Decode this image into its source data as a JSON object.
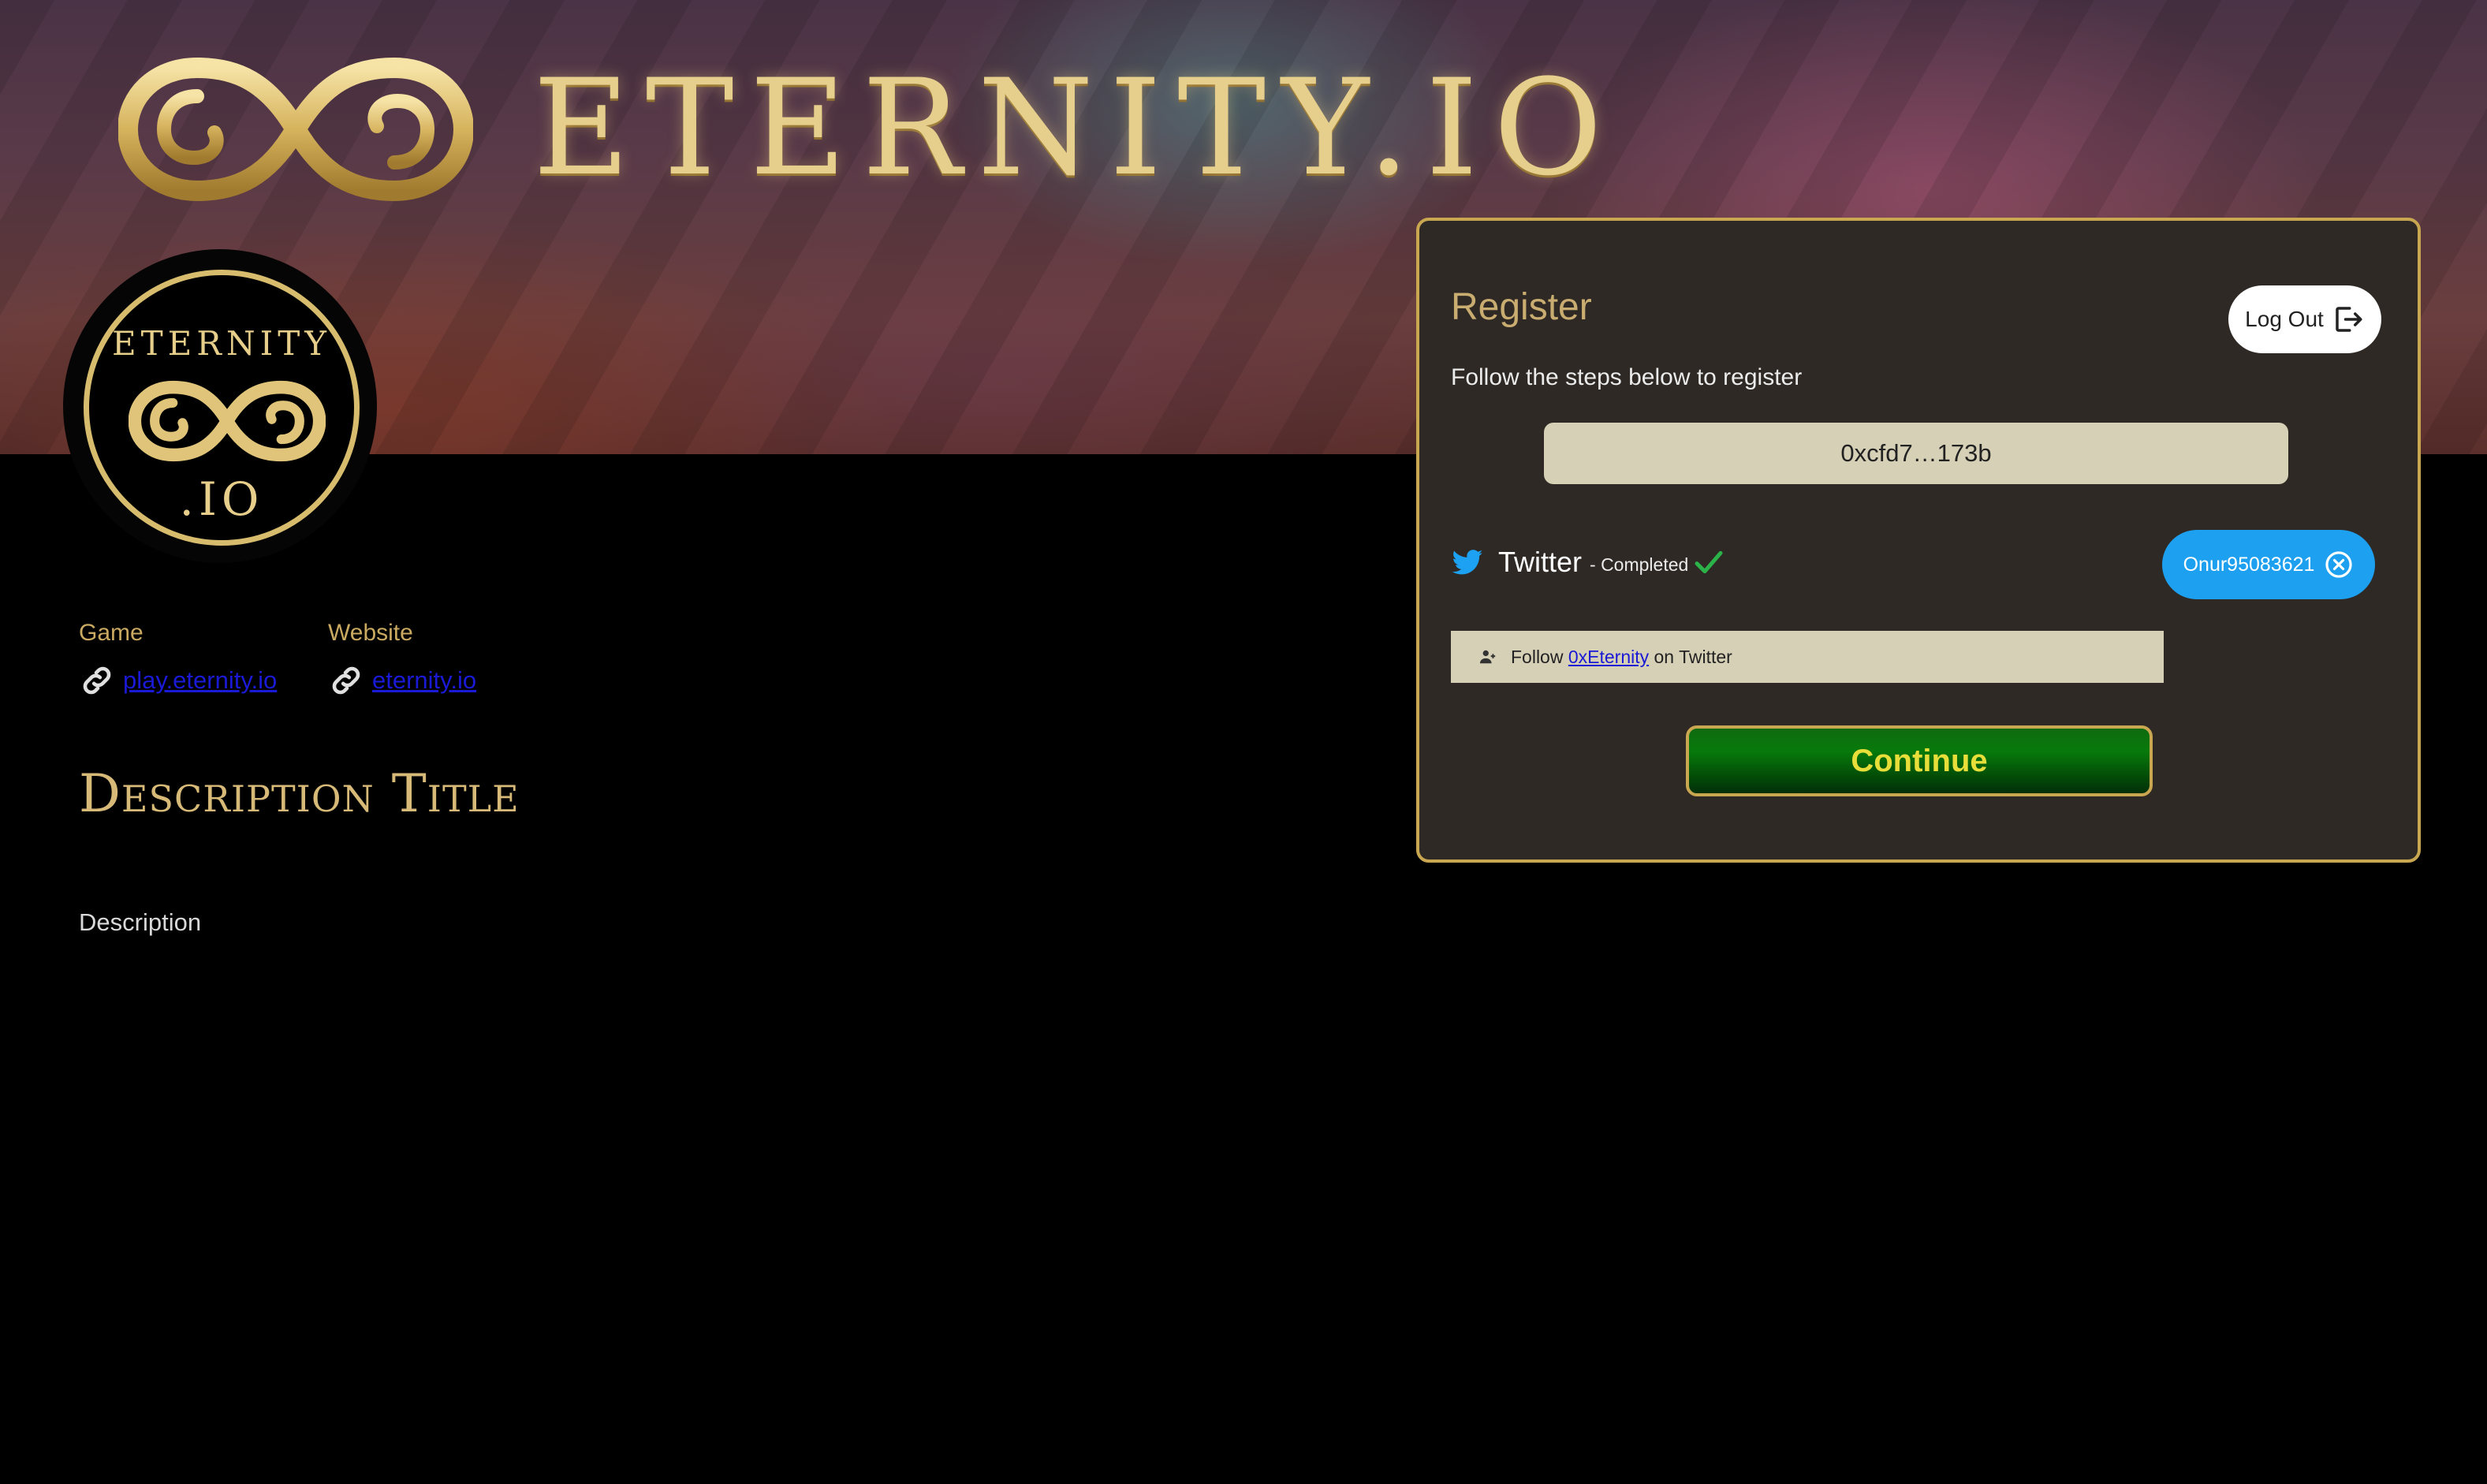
{
  "header": {
    "brand_name": "ETERNITY.IO",
    "logo_icon": "infinity-logo-icon"
  },
  "avatar": {
    "top_text": "ETERNITY",
    "bottom_text": ".IO"
  },
  "links": {
    "game": {
      "label": "Game",
      "url_text": "play.eternity.io",
      "icon": "link-icon"
    },
    "website": {
      "label": "Website",
      "url_text": "eternity.io",
      "icon": "link-icon"
    }
  },
  "description": {
    "title": "Description Title",
    "text": "Description"
  },
  "register": {
    "title": "Register",
    "logout_label": "Log Out",
    "subtitle": "Follow the steps below to register",
    "wallet_address": "0xcfd7…173b",
    "twitter": {
      "label": "Twitter",
      "status": "- Completed",
      "username": "Onur95083621"
    },
    "follow_task": {
      "prefix": "Follow ",
      "account": "0xEternity",
      "suffix": " on Twitter"
    },
    "continue_label": "Continue"
  },
  "colors": {
    "gold": "#c9a650",
    "panel_bg": "#2e2924",
    "twitter_blue": "#1ea0f1",
    "continue_green": "#077a0b",
    "continue_text": "#e8de3a",
    "link_blue": "#1a1ad6"
  }
}
